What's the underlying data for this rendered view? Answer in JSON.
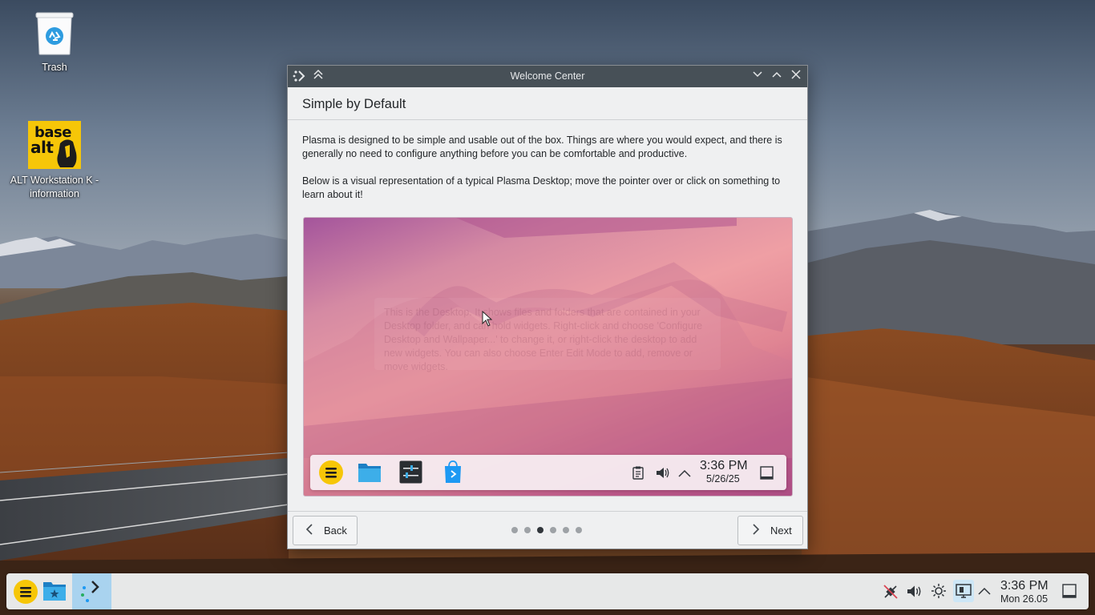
{
  "desktop": {
    "icons": [
      {
        "label": "Trash"
      },
      {
        "label": "ALT Workstation K - information",
        "logo_text_top": "base",
        "logo_text_bottom": "alt"
      }
    ]
  },
  "window": {
    "title": "Welcome Center",
    "heading": "Simple by Default",
    "paragraph1": "Plasma is designed to be simple and usable out of the box. Things are where you would expect, and there is generally no need to configure anything before you can be comfortable and productive.",
    "paragraph2": "Below is a visual representation of a typical Plasma Desktop; move the pointer over or click on something to learn about it!",
    "preview": {
      "tooltip_text": "This is the Desktop. It shows files and folders that are contained in your Desktop folder, and can hold widgets. Right-click and choose 'Configure Desktop and Wallpaper...' to change it, or right-click the desktop to add new widgets. You can also choose Enter Edit Mode to add, remove or move widgets.",
      "panel": {
        "time": "3:36 PM",
        "date": "5/26/25"
      }
    },
    "back_label": "Back",
    "next_label": "Next",
    "pages": {
      "count": 6,
      "current": 3
    }
  },
  "taskbar": {
    "time": "3:36 PM",
    "date": "Mon 26.05"
  },
  "colors": {
    "titlebar": "#475057",
    "window_bg": "#eff0f1",
    "accent": "#3daee9",
    "active_task": "#a9d3ef",
    "launcher_yellow": "#f6c608"
  }
}
